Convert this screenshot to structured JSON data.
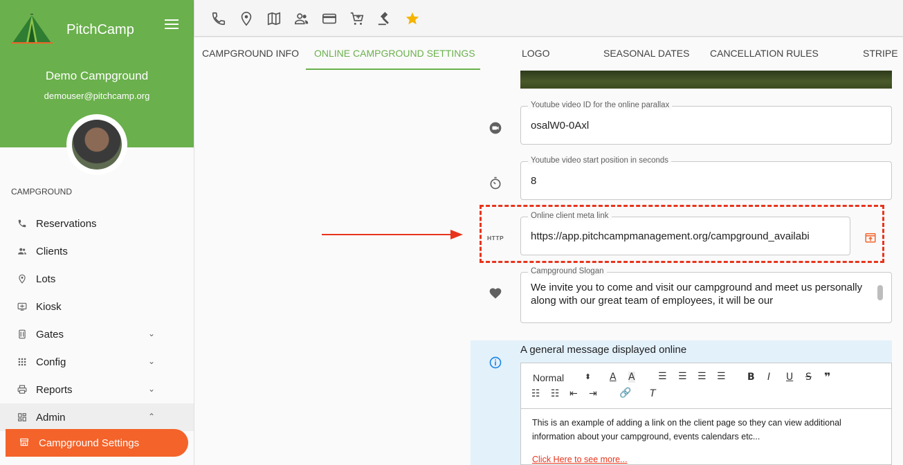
{
  "app": {
    "brand": "PitchCamp",
    "campground_name": "Demo Campground",
    "user_email": "demouser@pitchcamp.org"
  },
  "sidebar": {
    "section": "CAMPGROUND",
    "items": [
      {
        "label": "Reservations",
        "icon": "phone-icon"
      },
      {
        "label": "Clients",
        "icon": "people-icon"
      },
      {
        "label": "Lots",
        "icon": "location-pin-icon"
      },
      {
        "label": "Kiosk",
        "icon": "kiosk-icon"
      },
      {
        "label": "Gates",
        "icon": "gate-icon"
      },
      {
        "label": "Config",
        "icon": "grid-icon"
      },
      {
        "label": "Reports",
        "icon": "printer-icon"
      },
      {
        "label": "Admin",
        "icon": "dashboard-icon"
      }
    ],
    "active_sub": "Campground Settings"
  },
  "topbar": {
    "icons": [
      "phone-icon",
      "location-pin-icon",
      "map-icon",
      "people-icon",
      "credit-card-icon",
      "cart-icon",
      "gavel-icon",
      "star-icon"
    ]
  },
  "tabs": [
    "CAMPGROUND INFO",
    "ONLINE CAMPGROUND SETTINGS",
    "LOGO",
    "SEASONAL DATES",
    "CANCELLATION RULES",
    "STRIPE"
  ],
  "fields": {
    "youtube_id": {
      "label": "Youtube video ID for the online parallax",
      "value": "osalW0-0Axl"
    },
    "youtube_start": {
      "label": "Youtube video start position in seconds",
      "value": "8"
    },
    "meta_link": {
      "label": "Online client meta link",
      "value": "https://app.pitchcampmanagement.org/campground_availabi",
      "prefix": "HTTP"
    },
    "slogan": {
      "label": "Campground Slogan",
      "value": "We invite you to come and visit our campground and meet us personally along with our great team of employees, it will be our"
    }
  },
  "message": {
    "title": "A general message displayed online",
    "format": "Normal",
    "body": "This is an example of adding a link on the client page so they can view additional information about your campground, events calendars etc...",
    "link": "Click Here to see more..."
  },
  "colors": {
    "green": "#6ab04c",
    "orange": "#f4632a",
    "highlight": "#e8341c",
    "star": "#f5b400"
  }
}
